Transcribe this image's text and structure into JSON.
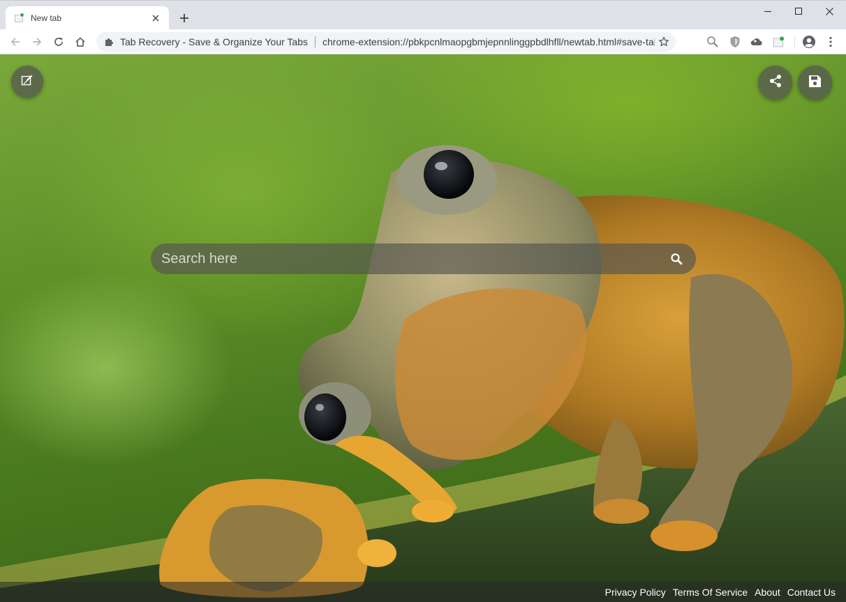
{
  "tab": {
    "title": "New tab"
  },
  "omnibox": {
    "extension_name": "Tab Recovery - Save & Organize Your Tabs",
    "url": "chrome-extension://pbkpcnlmaopgbmjepnnlinggpbdlhfll/newtab.html#save-tabs"
  },
  "search": {
    "placeholder": "Search here"
  },
  "footer": {
    "links": [
      "Privacy Policy",
      "Terms Of Service",
      "About",
      "Contact Us"
    ]
  },
  "icons": {
    "edit": "edit-icon",
    "share": "share-icon",
    "save": "floppy-disk-icon",
    "search": "search-icon",
    "back": "back-arrow-icon",
    "forward": "forward-arrow-icon",
    "reload": "reload-icon",
    "home": "home-icon",
    "star": "star-icon",
    "profile": "profile-icon",
    "menu": "kebab-menu-icon"
  },
  "colors": {
    "favicon_dot": "#34a853",
    "toolbar_bg": "#ffffff",
    "tabstrip_bg": "#dee1e6"
  }
}
